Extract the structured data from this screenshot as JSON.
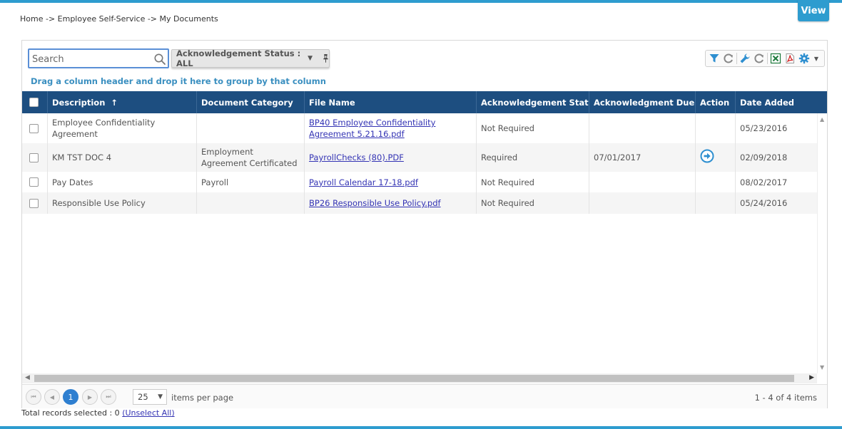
{
  "header": {
    "view_label": "View",
    "breadcrumb": "Home -> Employee Self-Service -> My Documents"
  },
  "search": {
    "placeholder": "Search"
  },
  "ack_filter": {
    "label": "Acknowledgement Status : ALL"
  },
  "group_hint": "Drag a column header and drop it here to group by that column",
  "columns": {
    "description": "Description",
    "sort_arrow": "↑",
    "category": "Document Category",
    "file": "File Name",
    "ack": "Acknowledgement Status",
    "due": "Acknowledgment Due...",
    "action": "Action",
    "date": "Date Added"
  },
  "rows": [
    {
      "description": "Employee Confidentiality Agreement",
      "category": "",
      "file": "BP40 Employee Confidentiality Agreement 5.21.16.pdf",
      "ack": "Not Required",
      "due": "",
      "date": "05/23/2016"
    },
    {
      "description": "KM TST DOC 4",
      "category": "Employment Agreement Certificated",
      "file": "PayrollChecks (80).PDF",
      "ack": "Required",
      "due": "07/01/2017",
      "date": "02/09/2018"
    },
    {
      "description": "Pay Dates",
      "category": "Payroll",
      "file": "Payroll Calendar 17-18.pdf",
      "ack": "Not Required",
      "due": "",
      "date": "08/02/2017"
    },
    {
      "description": "Responsible Use Policy",
      "category": "",
      "file": "BP26 Responsible Use Policy.pdf",
      "ack": "Not Required",
      "due": "",
      "date": "05/24/2016"
    }
  ],
  "pager": {
    "current_page": "1",
    "page_size": "25",
    "per_page_label": "items per page",
    "info": "1 - 4 of 4 items"
  },
  "selection": {
    "label": "Total records selected : 0",
    "unselect": "(Unselect All)"
  },
  "colors": {
    "accent": "#2e9ccf",
    "header_bg": "#1d4e80",
    "link": "#3434b4"
  }
}
